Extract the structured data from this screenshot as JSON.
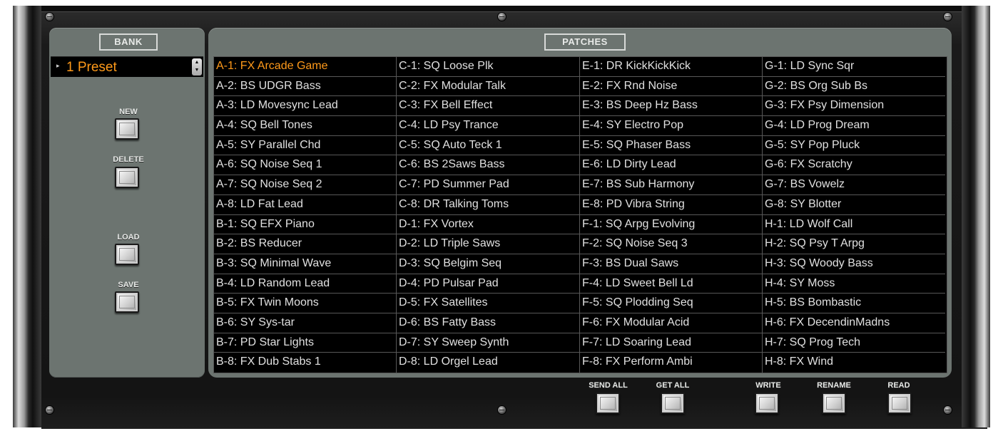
{
  "bank": {
    "title": "BANK",
    "selected": "1 Preset",
    "spin_up": "▲",
    "spin_down": "▼"
  },
  "patches": {
    "title": "PATCHES",
    "selected_index": 0,
    "columns": [
      [
        "A-1: FX Arcade Game",
        "A-2: BS UDGR Bass",
        "A-3: LD Movesync Lead",
        "A-4: SQ Bell Tones",
        "A-5: SY Parallel Chd",
        "A-6: SQ Noise Seq 1",
        "A-7: SQ Noise Seq 2",
        "A-8: LD Fat Lead",
        "B-1: SQ EFX Piano",
        "B-2: BS Reducer",
        "B-3: SQ Minimal Wave",
        "B-4: LD Random Lead",
        "B-5: FX Twin Moons",
        "B-6: SY Sys-tar",
        "B-7: PD Star Lights",
        "B-8: FX Dub Stabs 1"
      ],
      [
        "C-1: SQ Loose Plk",
        "C-2: FX Modular Talk",
        "C-3: FX Bell Effect",
        "C-4: LD Psy Trance",
        "C-5: SQ Auto Teck 1",
        "C-6: BS 2Saws Bass",
        "C-7: PD Summer Pad",
        "C-8: DR Talking Toms",
        "D-1: FX Vortex",
        "D-2: LD Triple Saws",
        "D-3: SQ Belgim Seq",
        "D-4: PD Pulsar Pad",
        "D-5: FX Satellites",
        "D-6: BS Fatty Bass",
        "D-7: SY Sweep Synth",
        "D-8: LD Orgel Lead"
      ],
      [
        "E-1: DR KickKickKick",
        "E-2: FX Rnd Noise",
        "E-3: BS Deep Hz Bass",
        "E-4: SY Electro Pop",
        "E-5: SQ Phaser Bass",
        "E-6: LD Dirty Lead",
        "E-7: BS Sub Harmony",
        "E-8: PD Vibra String",
        "F-1: SQ Arpg Evolving",
        "F-2: SQ Noise Seq 3",
        "F-3: BS Dual Saws",
        "F-4: LD Sweet Bell Ld",
        "F-5: SQ Plodding Seq",
        "F-6: FX Modular Acid",
        "F-7: LD Soaring Lead",
        "F-8: FX Perform Ambi"
      ],
      [
        "G-1: LD Sync Sqr",
        "G-2: BS Org Sub Bs",
        "G-3: FX Psy Dimension",
        "G-4: LD Prog Dream",
        "G-5: SY Pop Pluck",
        "G-6: FX Scratchy",
        "G-7: BS Vowelz",
        "G-8: SY Blotter",
        "H-1: LD Wolf Call",
        "H-2: SQ Psy T Arpg",
        "H-3: SQ Woody Bass",
        "H-4: SY Moss",
        "H-5: BS Bombastic",
        "H-6: FX DecendinMadns",
        "H-7: SQ Prog Tech",
        "H-8: FX Wind"
      ]
    ]
  },
  "buttons": {
    "new": "NEW",
    "delete": "DELETE",
    "load": "LOAD",
    "save": "SAVE",
    "send_all": "SEND ALL",
    "get_all": "GET ALL",
    "write": "WRITE",
    "rename": "RENAME",
    "read": "READ"
  },
  "colors": {
    "accent": "#ff9a1a",
    "panel": "#6c7470",
    "table_bg": "#000000",
    "text": "#e0e0e0"
  }
}
